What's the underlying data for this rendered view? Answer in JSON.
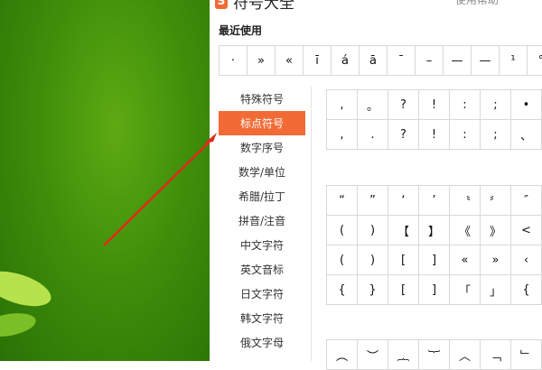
{
  "window": {
    "title": "符号大全",
    "header_right": "使用帮助"
  },
  "recent": {
    "heading": "最近使用",
    "symbols": [
      "·",
      "»",
      "«",
      "ī",
      "á",
      "ā",
      "¯",
      "–",
      "—",
      "—",
      "¹",
      "°"
    ]
  },
  "categories": [
    {
      "label": "特殊符号"
    },
    {
      "label": "标点符号",
      "active": true
    },
    {
      "label": "数字序号"
    },
    {
      "label": "数学/单位"
    },
    {
      "label": "希腊/拉丁"
    },
    {
      "label": "拼音/注音"
    },
    {
      "label": "中文字符"
    },
    {
      "label": "英文音标"
    },
    {
      "label": "日文字符"
    },
    {
      "label": "韩文字符"
    },
    {
      "label": "俄文字母"
    }
  ],
  "symbol_groups": [
    {
      "rows": [
        [
          ",",
          "。",
          "?",
          "!",
          ":",
          ";",
          "•"
        ],
        [
          ",",
          ".",
          "?",
          "!",
          ":",
          ";",
          "、"
        ]
      ]
    },
    {
      "rows": [
        [
          "“",
          "”",
          "‘",
          "’",
          "〝",
          "〞",
          "″"
        ],
        [
          "(",
          ")",
          "【",
          "】",
          "《",
          "》",
          "<"
        ],
        [
          "(",
          ")",
          "[",
          "]",
          "«",
          "»",
          "‹"
        ],
        [
          "{",
          "}",
          "[",
          "]",
          "「",
          "」",
          "{"
        ]
      ]
    },
    {
      "rows": [
        [
          "︵",
          "︶",
          "︷",
          "︸",
          "︿",
          "﹁",
          "﹂"
        ]
      ]
    }
  ],
  "colors": {
    "accent": "#f26b36",
    "background_green": "#3f8f0a",
    "arrow": "#e02a1a"
  }
}
